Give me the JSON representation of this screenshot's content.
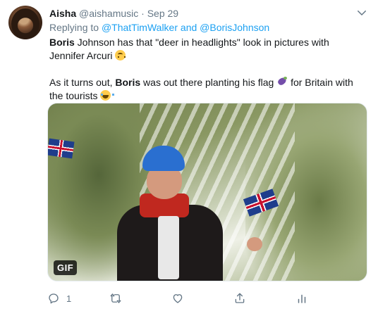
{
  "tweet": {
    "author_name": "Aisha",
    "author_handle": "@aishamusic",
    "separator": "·",
    "date": "Sep 29",
    "replying_to_label": "Replying to",
    "reply_users": [
      "@ThatTimWalker",
      "and",
      "@BorisJohnson"
    ],
    "para1": {
      "bold": "Boris",
      "text": " Johnson has that \"deer in headlights\" look in pictures with Jennifer Arcuri "
    },
    "para2": {
      "prefix": "As it turns out, ",
      "bold": "Boris",
      "middle": " was out there planting his flag ",
      "suffix": " for Britain with the tourists "
    },
    "media": {
      "badge": "GIF"
    },
    "actions": {
      "reply_count": "1",
      "retweet_count": "",
      "like_count": ""
    },
    "icons": [
      "chevron-down-icon",
      "reply-icon",
      "retweet-icon",
      "like-icon",
      "share-icon",
      "analytics-icon"
    ],
    "colors": {
      "link": "#1da1f2",
      "muted": "#657786",
      "text": "#14171a"
    }
  }
}
